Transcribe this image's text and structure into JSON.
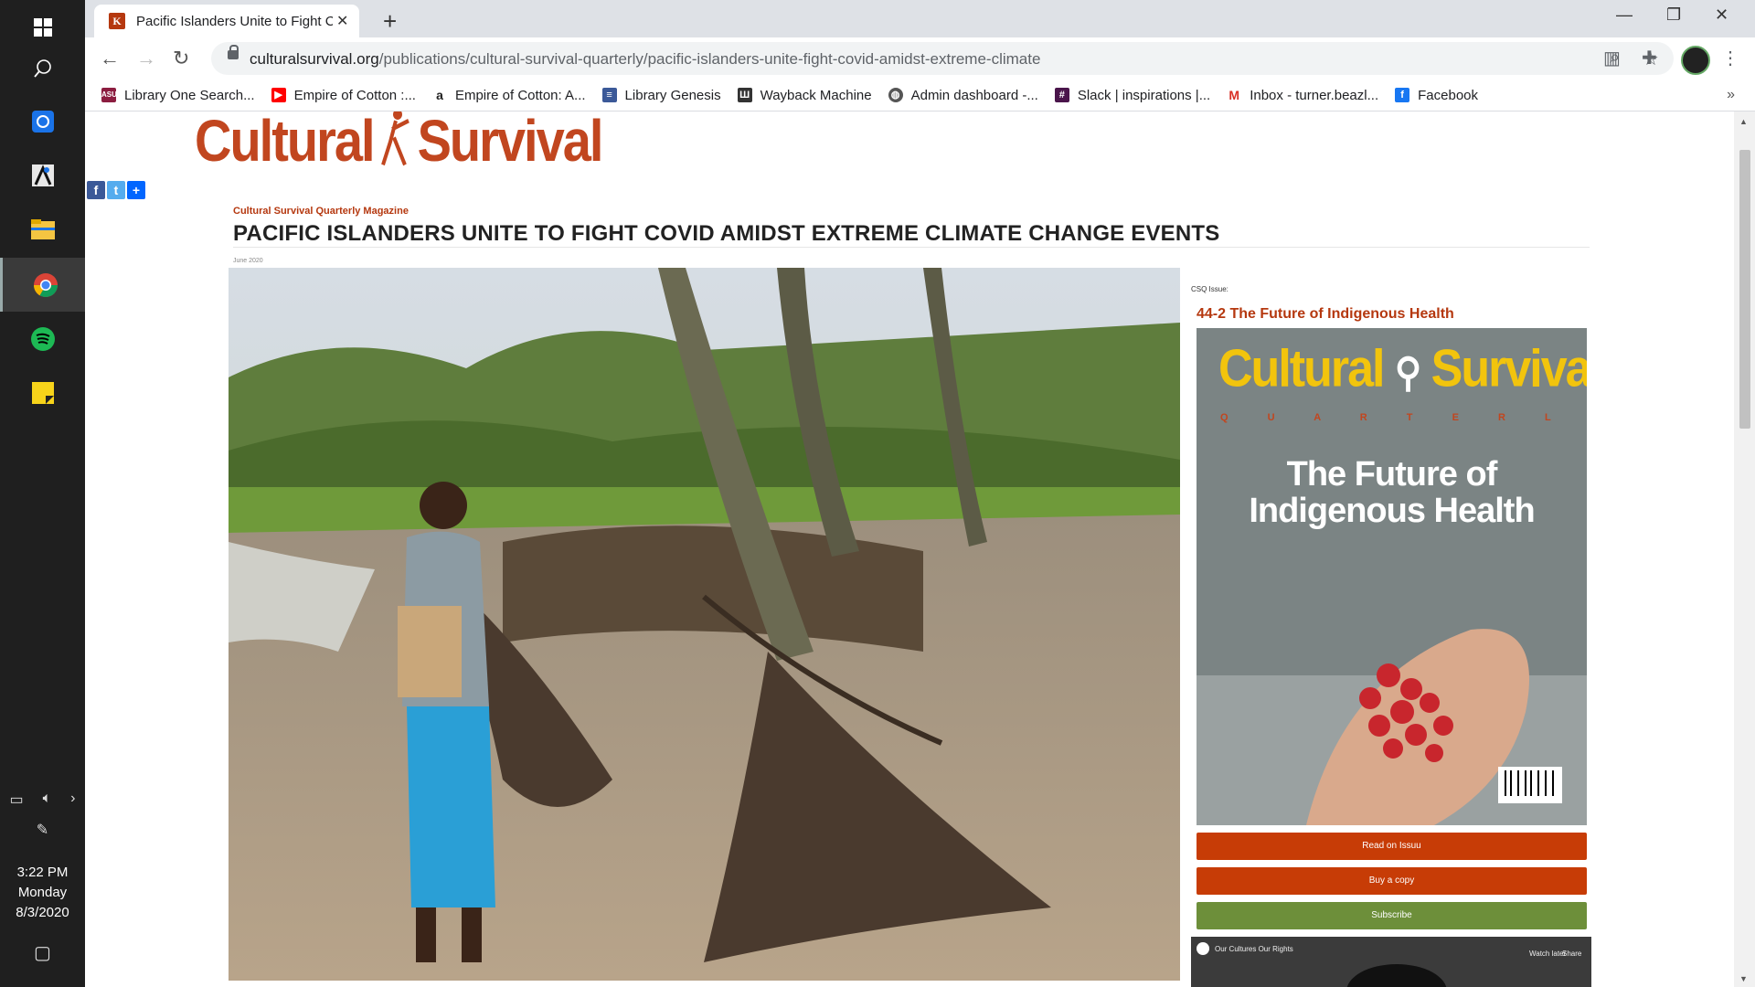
{
  "taskbar": {
    "apps": [
      {
        "icon": "windows-start-icon"
      },
      {
        "icon": "search-icon"
      },
      {
        "icon": "screen-reader-icon"
      },
      {
        "icon": "accessibility-app-icon"
      },
      {
        "icon": "file-explorer-icon"
      },
      {
        "icon": "chrome-icon"
      },
      {
        "icon": "spotify-icon"
      },
      {
        "icon": "sticky-notes-icon"
      }
    ],
    "time": "3:22 PM",
    "day": "Monday",
    "date": "8/3/2020"
  },
  "browser": {
    "tab_title": "Pacific Islanders Unite to Fight COVID Amidst Extreme Climate",
    "url_host": "culturalsurvival.org",
    "url_path": "/publications/cultural-survival-quarterly/pacific-islanders-unite-fight-covid-amidst-extreme-climate",
    "bookmarks": [
      {
        "label": "Library One Search...",
        "icon": "asu-icon",
        "color": "#8c1d40"
      },
      {
        "label": "Empire of Cotton :...",
        "icon": "youtube-icon",
        "color": "#ff0000"
      },
      {
        "label": "Empire of Cotton: A...",
        "icon": "amazon-icon",
        "color": "#222222"
      },
      {
        "label": "Library Genesis",
        "icon": "libgen-icon",
        "color": "#3b5998"
      },
      {
        "label": "Wayback Machine",
        "icon": "archive-icon",
        "color": "#333333"
      },
      {
        "label": "Admin dashboard -...",
        "icon": "globe-icon",
        "color": "#555555"
      },
      {
        "label": "Slack | inspirations |...",
        "icon": "slack-icon",
        "color": "#4a154b"
      },
      {
        "label": "Inbox - turner.beazl...",
        "icon": "gmail-icon",
        "color": "#d93025"
      },
      {
        "label": "Facebook",
        "icon": "facebook-icon",
        "color": "#1877f2"
      }
    ]
  },
  "site": {
    "logo_left": "Cultural",
    "logo_right": "Survival",
    "brand_color": "#c1461f"
  },
  "article": {
    "kicker": "Cultural Survival Quarterly Magazine",
    "headline": "PACIFIC ISLANDERS UNITE TO FIGHT COVID AMIDST EXTREME CLIMATE CHANGE EVENTS",
    "date": "June 2020"
  },
  "sidebar": {
    "csq_label": "CSQ Issue:",
    "issue_title": "44-2 The Future of Indigenous Health",
    "cover": {
      "masthead_left": "Cultural",
      "masthead_right": "Survival",
      "quarterly": "Q U A R T E R L Y",
      "headline_line1": "The Future of",
      "headline_line2": "Indigenous Health"
    },
    "read_label": "Read on Issuu",
    "buy_label": "Buy a copy",
    "subscribe_label": "Subscribe",
    "video_title": "Our Cultures Our Rights",
    "video_watch": "Watch later",
    "video_share": "Share"
  }
}
